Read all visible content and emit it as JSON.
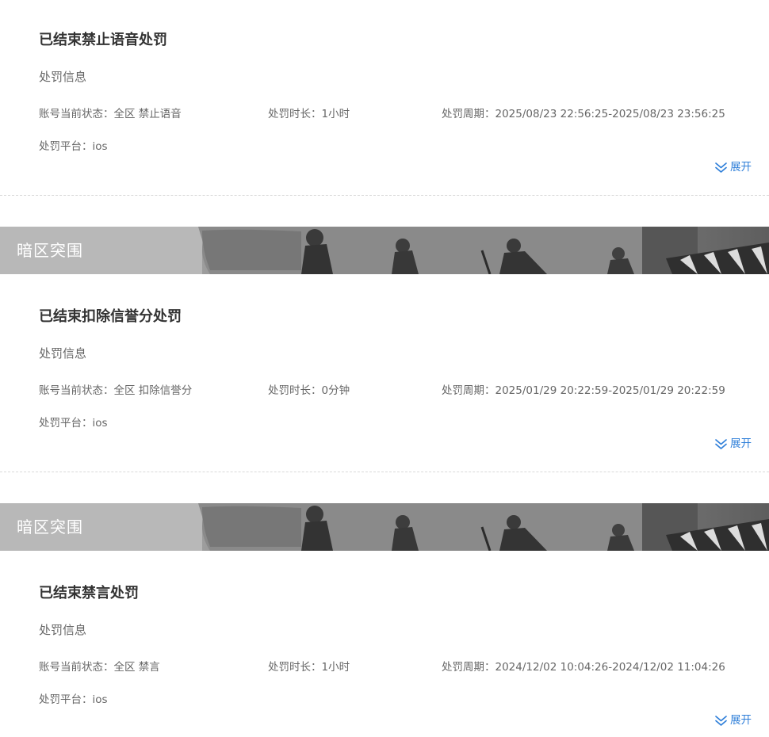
{
  "records": [
    {
      "title": "已结束禁止语音处罚",
      "info_heading": "处罚信息",
      "status_label": "账号当前状态：",
      "status_value": "全区 禁止语音",
      "duration_label": "处罚时长：",
      "duration_value": "1小时",
      "period_label": "处罚周期：",
      "period_value": "2025/08/23 22:56:25-2025/08/23 23:56:25",
      "platform_label": "处罚平台：",
      "platform_value": "ios",
      "expand_label": "展开"
    },
    {
      "title": "已结束扣除信誉分处罚",
      "info_heading": "处罚信息",
      "status_label": "账号当前状态：",
      "status_value": "全区 扣除信誉分",
      "duration_label": "处罚时长：",
      "duration_value": "0分钟",
      "period_label": "处罚周期：",
      "period_value": "2025/01/29 20:22:59-2025/01/29 20:22:59",
      "platform_label": "处罚平台：",
      "platform_value": "ios",
      "expand_label": "展开"
    },
    {
      "title": "已结束禁言处罚",
      "info_heading": "处罚信息",
      "status_label": "账号当前状态：",
      "status_value": "全区 禁言",
      "duration_label": "处罚时长：",
      "duration_value": "1小时",
      "period_label": "处罚周期：",
      "period_value": "2024/12/02 10:04:26-2024/12/02 11:04:26",
      "platform_label": "处罚平台：",
      "platform_value": "ios",
      "expand_label": "展开"
    }
  ],
  "banners": [
    {
      "game_title": "暗区突围"
    },
    {
      "game_title": "暗区突围"
    }
  ],
  "icons": {
    "expand": "double-chevron-down-icon"
  },
  "colors": {
    "accent": "#2f7fd9",
    "title_text": "#333333",
    "body_text": "#666666"
  }
}
